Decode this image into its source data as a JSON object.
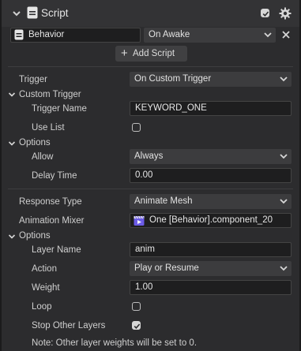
{
  "header": {
    "title": "Script"
  },
  "top_row": {
    "behavior_field": "Behavior",
    "event_dropdown": "On Awake",
    "add_script_label": "Add Script"
  },
  "trigger": {
    "label": "Trigger",
    "value": "On Custom Trigger",
    "group_label": "Custom Trigger",
    "trigger_name_label": "Trigger Name",
    "trigger_name_value": "KEYWORD_ONE",
    "use_list_label": "Use List",
    "use_list_checked": false
  },
  "options1": {
    "group_label": "Options",
    "allow_label": "Allow",
    "allow_value": "Always",
    "delay_label": "Delay Time",
    "delay_value": "0.00"
  },
  "response": {
    "label": "Response Type",
    "value": "Animate Mesh",
    "mixer_label": "Animation Mixer",
    "mixer_value": "One [Behavior].component_20"
  },
  "options2": {
    "group_label": "Options",
    "layer_name_label": "Layer Name",
    "layer_name_value": "anim",
    "action_label": "Action",
    "action_value": "Play or Resume",
    "weight_label": "Weight",
    "weight_value": "1.00",
    "loop_label": "Loop",
    "loop_checked": false,
    "stop_label": "Stop Other Layers",
    "stop_checked": true,
    "note": "Note: Other layer weights will be set to 0."
  },
  "icons": [
    "chevron-down-icon",
    "script-icon",
    "checkbox-icon",
    "gear-icon",
    "close-icon",
    "plus-icon",
    "animation-clip-icon"
  ],
  "colors": {
    "background": "#2c2c2e",
    "header": "#333335",
    "field": "#1e1e1f",
    "dropdown": "#3c3c3e",
    "accent": "#8e7cff"
  }
}
